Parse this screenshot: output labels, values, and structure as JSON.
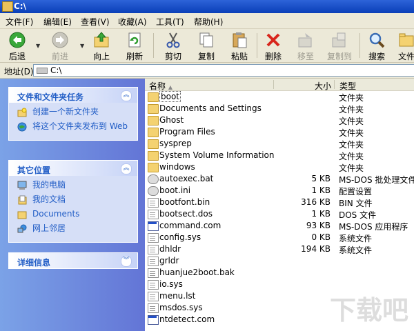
{
  "title": "C:\\",
  "menu": [
    "文件(F)",
    "编辑(E)",
    "查看(V)",
    "收藏(A)",
    "工具(T)",
    "帮助(H)"
  ],
  "toolbar": {
    "back": "后退",
    "forward": "前进",
    "up": "向上",
    "refresh": "刷新",
    "cut": "剪切",
    "copy": "复制",
    "paste": "粘贴",
    "delete": "删除",
    "move_to": "移至",
    "copy_to": "复制到",
    "search": "搜索",
    "folders": "文件"
  },
  "address": {
    "label": "地址(D)",
    "value": "C:\\"
  },
  "tasks": {
    "title": "文件和文件夹任务",
    "items": [
      "创建一个新文件夹",
      "将这个文件夹发布到 Web"
    ]
  },
  "places": {
    "title": "其它位置",
    "items": [
      "我的电脑",
      "我的文档",
      "Documents",
      "网上邻居"
    ]
  },
  "details": {
    "title": "详细信息"
  },
  "columns": {
    "name": "名称",
    "size": "大小",
    "type": "类型"
  },
  "files": [
    {
      "name": "boot",
      "size": "",
      "type": "文件夹",
      "icon": "folder-icon"
    },
    {
      "name": "Documents and Settings",
      "size": "",
      "type": "文件夹",
      "icon": "folder-icon"
    },
    {
      "name": "Ghost",
      "size": "",
      "type": "文件夹",
      "icon": "folder-icon"
    },
    {
      "name": "Program Files",
      "size": "",
      "type": "文件夹",
      "icon": "folder-icon"
    },
    {
      "name": "sysprep",
      "size": "",
      "type": "文件夹",
      "icon": "folder-icon"
    },
    {
      "name": "System Volume Information",
      "size": "",
      "type": "文件夹",
      "icon": "folder-icon"
    },
    {
      "name": "windows",
      "size": "",
      "type": "文件夹",
      "icon": "folder-icon"
    },
    {
      "name": "autoexec.bat",
      "size": "5 KB",
      "type": "MS-DOS 批处理文件",
      "icon": "gear-icon"
    },
    {
      "name": "boot.ini",
      "size": "1 KB",
      "type": "配置设置",
      "icon": "gear-icon"
    },
    {
      "name": "bootfont.bin",
      "size": "316 KB",
      "type": "BIN 文件",
      "icon": "document-icon"
    },
    {
      "name": "bootsect.dos",
      "size": "1 KB",
      "type": "DOS 文件",
      "icon": "document-icon"
    },
    {
      "name": "command.com",
      "size": "93 KB",
      "type": "MS-DOS 应用程序",
      "icon": "window-icon"
    },
    {
      "name": "config.sys",
      "size": "0 KB",
      "type": "系统文件",
      "icon": "document-icon"
    },
    {
      "name": "dhldr",
      "size": "194 KB",
      "type": "系统文件",
      "icon": "document-icon"
    },
    {
      "name": "grldr",
      "size": "",
      "type": "",
      "icon": "document-icon"
    },
    {
      "name": "huanjue2boot.bak",
      "size": "",
      "type": "",
      "icon": "document-icon"
    },
    {
      "name": "io.sys",
      "size": "",
      "type": "",
      "icon": "document-icon"
    },
    {
      "name": "menu.lst",
      "size": "",
      "type": "",
      "icon": "document-icon"
    },
    {
      "name": "msdos.sys",
      "size": "",
      "type": "",
      "icon": "document-icon"
    },
    {
      "name": "ntdetect.com",
      "size": "",
      "type": "",
      "icon": "window-icon"
    }
  ],
  "watermark": "下载吧"
}
